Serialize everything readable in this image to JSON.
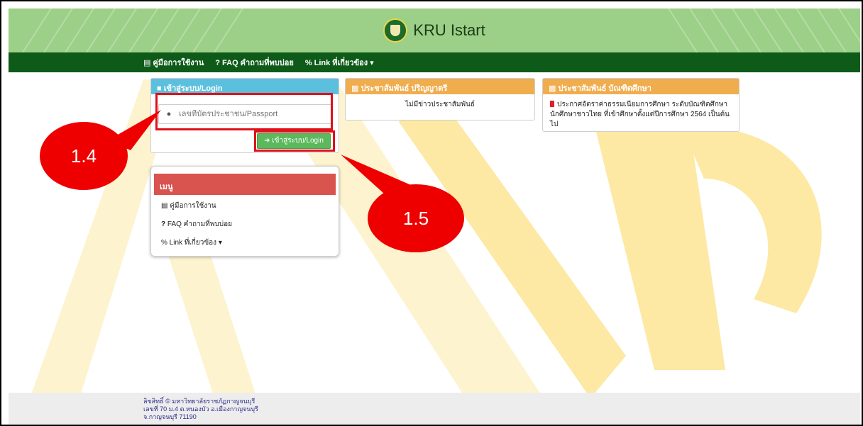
{
  "header": {
    "title": "KRU Istart"
  },
  "nav": {
    "items": [
      {
        "icon": "book-icon",
        "label": "คู่มือการใช้งาน"
      },
      {
        "icon": "question-icon",
        "label": "FAQ คำถามที่พบบ่อย"
      },
      {
        "icon": "link-icon",
        "label": "Link ที่เกี่ยวข้อง"
      }
    ]
  },
  "login": {
    "header": "เข้าสู่ระบบ/Login",
    "placeholder": "เลขที่บัตรประชาชน/Passport",
    "button": "เข้าสู่ระบบ/Login"
  },
  "news_bachelor": {
    "header": "ประชาสัมพันธ์ ปริญญาตรี",
    "body": "ไม่มีข่าวประชาสัมพันธ์"
  },
  "news_graduate": {
    "header": "ประชาสัมพันธ์ บัณฑิตศึกษา",
    "body": "ประกาศอัตราค่าธรรมเนียมการศึกษา ระดับบัณฑิตศึกษา นักศึกษาชาวไทย ที่เข้าศึกษาตั้งแต่ปีการศึกษา 2564 เป็นต้นไป"
  },
  "menu": {
    "header": "เมนู",
    "items": [
      {
        "icon": "book-icon",
        "label": "คู่มือการใช้งาน"
      },
      {
        "icon": "question-icon",
        "label": "FAQ คำถามที่พบบ่อย"
      },
      {
        "icon": "link-icon",
        "label": "Link ที่เกี่ยวข้อง"
      }
    ]
  },
  "callouts": [
    "1.4",
    "1.5"
  ],
  "footer": {
    "lines": [
      "ลิขสิทธิ์ © มหาวิทยาลัยราชภัฏกาญจนบุรี",
      "เลขที่ 70 ม.4 ต.หนองบัว อ.เมืองกาญจนบุรี",
      "จ.กาญจนบุรี 71190"
    ]
  },
  "colors": {
    "header_green": "#9ccf87",
    "nav_green": "#0e5b19",
    "login_blue": "#5bc0de",
    "news_orange": "#f0ad4e",
    "menu_red": "#d9534f",
    "callout_red": "#ee0000",
    "watermark_yellow": "#fde9a4"
  }
}
